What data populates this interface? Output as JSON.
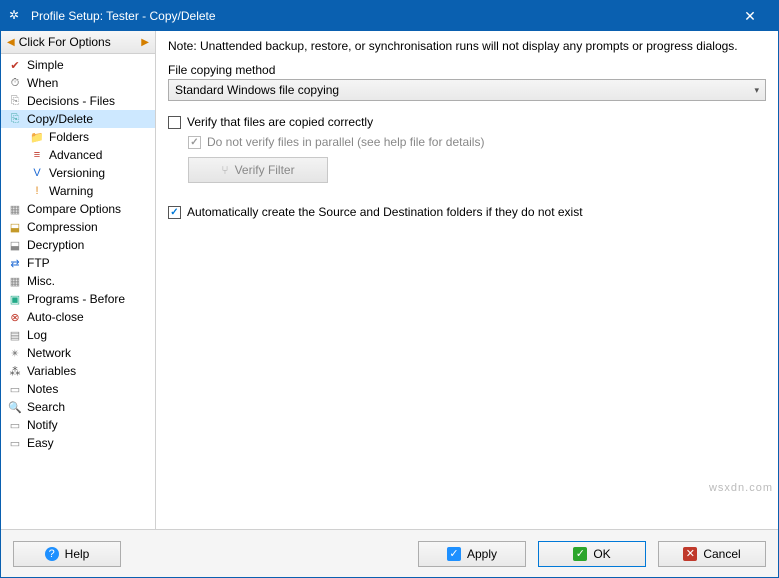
{
  "title": "Profile Setup: Tester - Copy/Delete",
  "sidebar": {
    "header": "Click For Options",
    "items": [
      {
        "label": "Simple",
        "icon": "✔",
        "iconColor": "#c0392b"
      },
      {
        "label": "When",
        "icon": "⏱",
        "iconColor": "#555"
      },
      {
        "label": "Decisions - Files",
        "icon": "⎘",
        "iconColor": "#888"
      },
      {
        "label": "Copy/Delete",
        "icon": "⎘",
        "iconColor": "#4aa",
        "selected": true
      },
      {
        "label": "Folders",
        "icon": "📁",
        "iconColor": "#d8a030",
        "child": true
      },
      {
        "label": "Advanced",
        "icon": "≡",
        "iconColor": "#c0392b",
        "child": true
      },
      {
        "label": "Versioning",
        "icon": "V",
        "iconColor": "#1e6ad4",
        "child": true
      },
      {
        "label": "Warning",
        "icon": "!",
        "iconColor": "#e08a1e",
        "child": true
      },
      {
        "label": "Compare Options",
        "icon": "▦",
        "iconColor": "#888"
      },
      {
        "label": "Compression",
        "icon": "⬓",
        "iconColor": "#c49a2a"
      },
      {
        "label": "Decryption",
        "icon": "⬓",
        "iconColor": "#888"
      },
      {
        "label": "FTP",
        "icon": "⇄",
        "iconColor": "#1e6ad4"
      },
      {
        "label": "Misc.",
        "icon": "▦",
        "iconColor": "#888"
      },
      {
        "label": "Programs - Before",
        "icon": "▣",
        "iconColor": "#2a8"
      },
      {
        "label": "Auto-close",
        "icon": "⊗",
        "iconColor": "#c0392b"
      },
      {
        "label": "Log",
        "icon": "▤",
        "iconColor": "#888"
      },
      {
        "label": "Network",
        "icon": "✴",
        "iconColor": "#888"
      },
      {
        "label": "Variables",
        "icon": "⁂",
        "iconColor": "#555"
      },
      {
        "label": "Notes",
        "icon": "▭",
        "iconColor": "#888"
      },
      {
        "label": "Search",
        "icon": "🔍",
        "iconColor": "#555"
      },
      {
        "label": "Notify",
        "icon": "▭",
        "iconColor": "#888"
      },
      {
        "label": "Easy",
        "icon": "▭",
        "iconColor": "#888"
      }
    ]
  },
  "main": {
    "note": "Note: Unattended backup, restore, or synchronisation runs will not display any prompts or progress dialogs.",
    "copyMethodLabel": "File copying method",
    "copyMethodValue": "Standard Windows file copying",
    "verifyLabel": "Verify that files are copied correctly",
    "verifyChecked": false,
    "noParallelLabel": "Do not verify files in parallel (see help file for details)",
    "noParallelChecked": true,
    "verifyFilterLabel": "Verify Filter",
    "autoCreateLabel": "Automatically create the Source and Destination folders if they do not exist",
    "autoCreateChecked": true
  },
  "footer": {
    "help": "Help",
    "apply": "Apply",
    "ok": "OK",
    "cancel": "Cancel"
  },
  "watermark": "wsxdn.com"
}
